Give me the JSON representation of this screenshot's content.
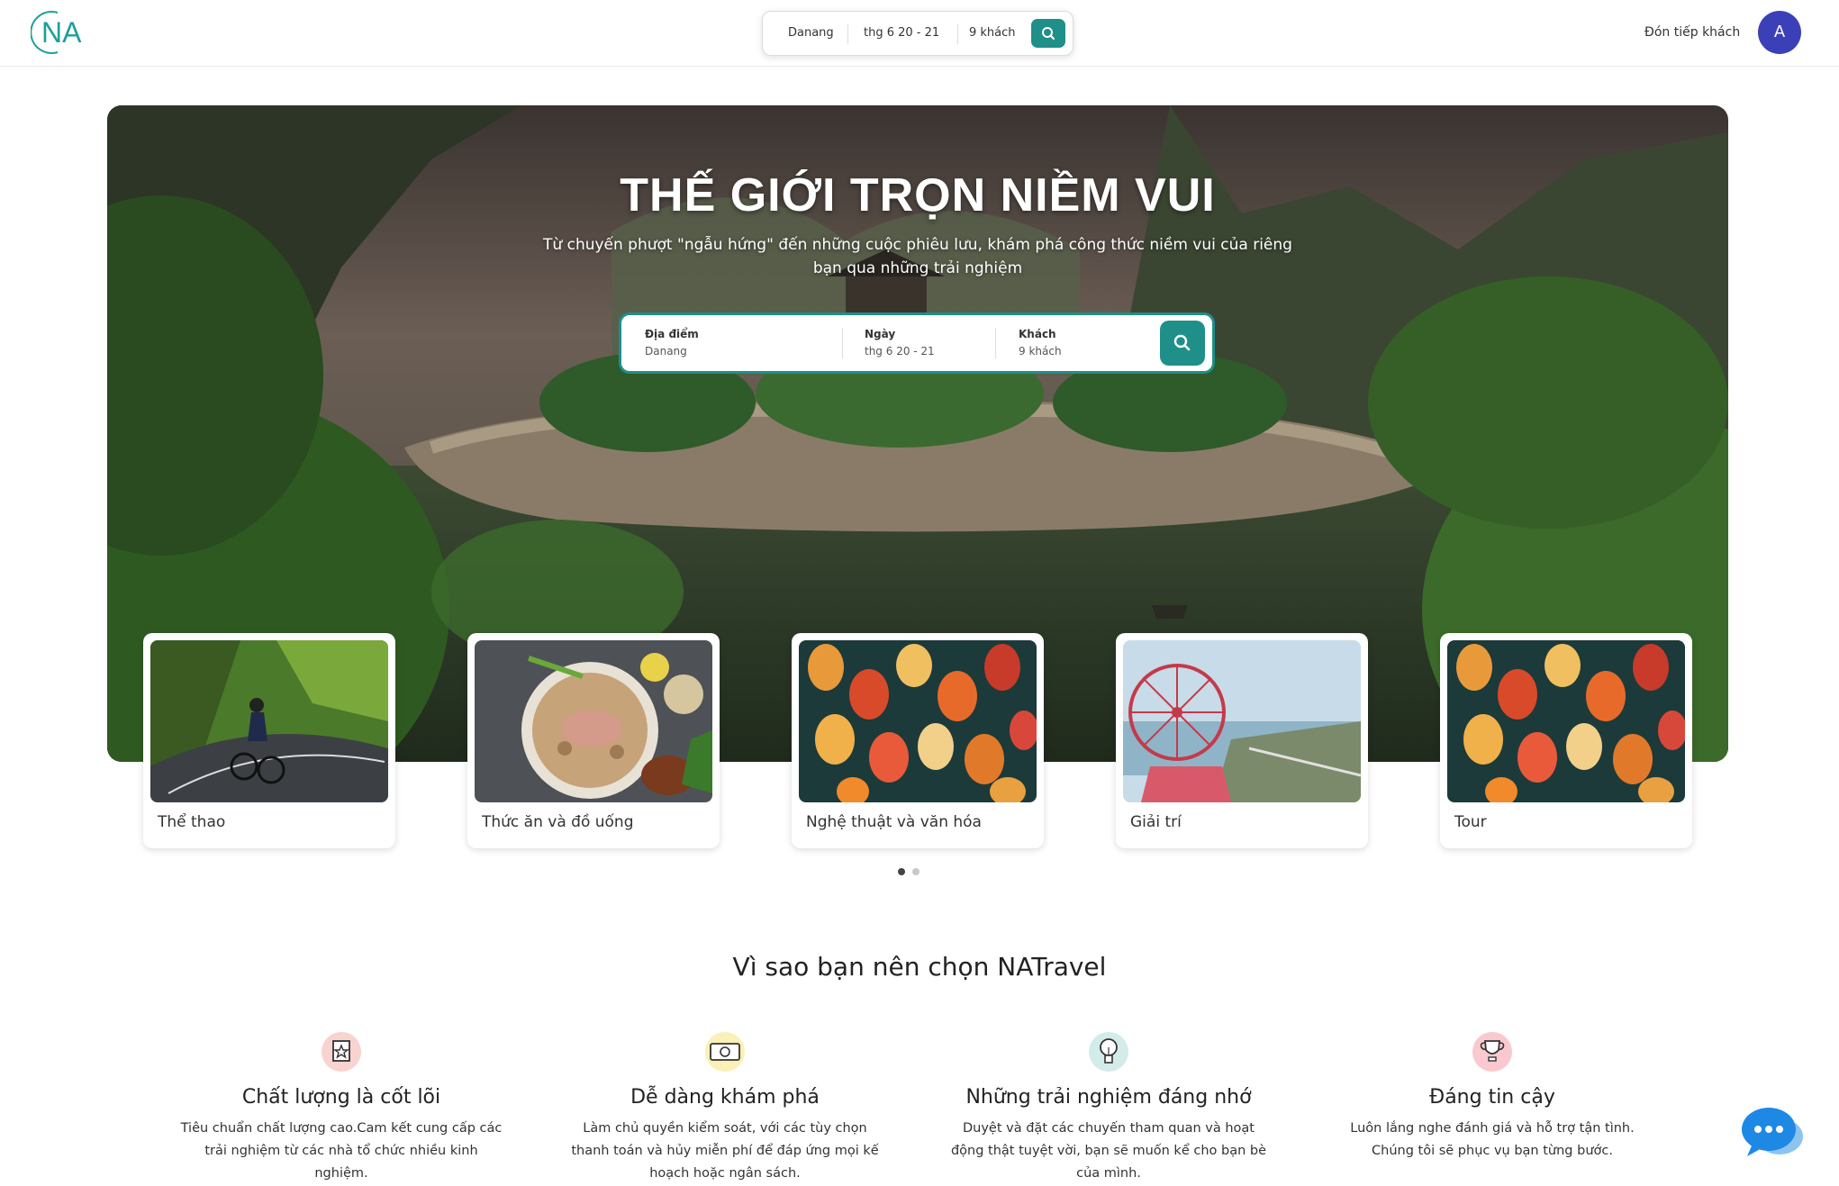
{
  "header": {
    "logo_text": "NA",
    "search": {
      "location": "Danang",
      "date": "thg 6 20 - 21",
      "guests": "9 khách"
    },
    "host_link": "Đón tiếp khách",
    "avatar_initial": "A"
  },
  "hero": {
    "title": "THẾ GIỚI TRỌN NIỀM VUI",
    "subtitle": "Từ chuyến phượt \"ngẫu hứng\" đến những cuộc phiêu lưu, khám phá công thức niềm vui của riêng bạn qua những trải nghiệm",
    "search": {
      "location_label": "Địa điểm",
      "location_value": "Danang",
      "date_label": "Ngày",
      "date_value": "thg 6 20 - 21",
      "guests_label": "Khách",
      "guests_value": "9 khách"
    }
  },
  "categories": [
    {
      "label": "Thể thao",
      "icon": "cyclist-photo"
    },
    {
      "label": "Thức ăn và đồ uống",
      "icon": "pho-bowl-photo"
    },
    {
      "label": "Nghệ thuật và văn hóa",
      "icon": "lanterns-photo"
    },
    {
      "label": "Giải trí",
      "icon": "ferris-wheel-photo"
    },
    {
      "label": "Tour",
      "icon": "lanterns-photo"
    }
  ],
  "carousel": {
    "page_count": 2,
    "active_index": 0
  },
  "why": {
    "title": "Vì sao bạn nên chọn NATravel",
    "features": [
      {
        "title": "Chất lượng là cốt lõi",
        "desc": "Tiêu chuẩn chất lượng cao.Cam kết cung cấp các trải nghiệm từ các nhà tổ chức nhiều kinh nghiệm.",
        "icon": "quality-badge-icon"
      },
      {
        "title": "Dễ dàng khám phá",
        "desc": "Làm chủ quyền kiểm soát, với các tùy chọn thanh toán và hủy miễn phí để đáp ứng mọi kế hoạch hoặc ngân sách.",
        "icon": "money-icon"
      },
      {
        "title": "Những trải nghiệm đáng nhớ",
        "desc": "Duyệt và đặt các chuyến tham quan và hoạt động thật tuyệt vời, bạn sẽ muốn kể cho bạn bè của mình.",
        "icon": "lightbulb-icon"
      },
      {
        "title": "Đáng tin cậy",
        "desc": "Luôn lắng nghe đánh giá và hỗ trợ tận tình. Chúng tôi sẽ phục vụ bạn từng bước.",
        "icon": "trophy-icon"
      }
    ]
  },
  "colors": {
    "brand_teal": "#1f8f8a",
    "avatar": "#3b40b8",
    "chat_blue": "#1e88e5",
    "icon_bg_pink": "#f9d3cf",
    "icon_bg_yellow": "#fbf0b8",
    "icon_bg_teal": "#d3ecea",
    "icon_bg_red": "#f9c9cf"
  }
}
